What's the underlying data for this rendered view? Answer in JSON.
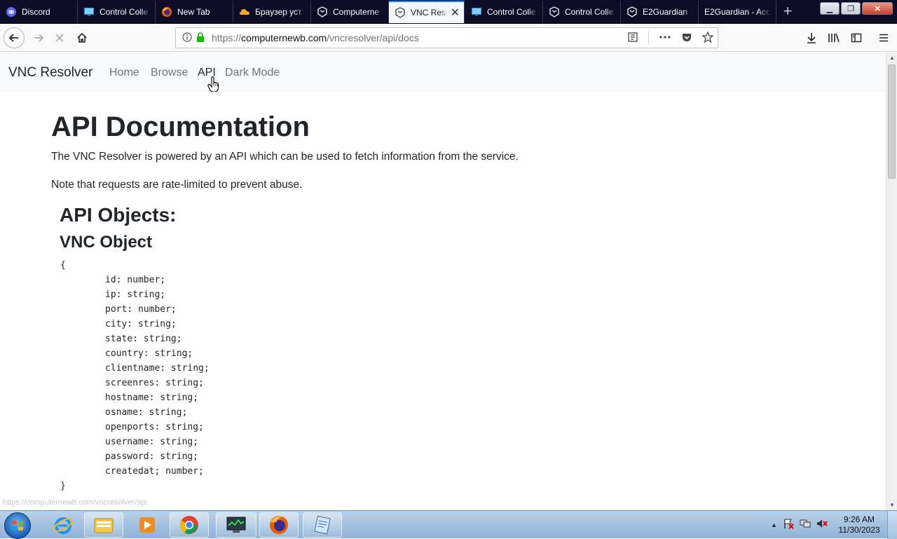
{
  "browser": {
    "tabs": [
      {
        "label": "Discord",
        "icon": "discord-icon",
        "active": false
      },
      {
        "label": "Control Colle",
        "icon": "monitor-icon",
        "active": false
      },
      {
        "label": "New Tab",
        "icon": "firefox-icon",
        "active": false
      },
      {
        "label": "Браузер уст",
        "icon": "cloud-icon",
        "active": false
      },
      {
        "label": "Computerne",
        "icon": "computernewb-icon",
        "active": false
      },
      {
        "label": "VNC Reso",
        "icon": "computernewb-icon",
        "active": true
      },
      {
        "label": "Control Colle",
        "icon": "monitor-icon",
        "active": false
      },
      {
        "label": "Control Colle",
        "icon": "computernewb-icon",
        "active": false
      },
      {
        "label": "E2Guardian",
        "icon": "computernewb-icon",
        "active": false
      },
      {
        "label": "E2Guardian - Acc",
        "icon": "",
        "active": false
      }
    ],
    "new_tab_label": "+",
    "window_controls": {
      "minimize": "▁",
      "maximize": "❐",
      "close": "✕"
    },
    "url": {
      "prefix": "https://",
      "host": "computernewb.com",
      "path": "/vncresolver/api/docs"
    }
  },
  "page": {
    "navbar": {
      "brand": "VNC Resolver",
      "links": [
        {
          "label": "Home",
          "active": false
        },
        {
          "label": "Browse",
          "active": false
        },
        {
          "label": "API",
          "active": true
        },
        {
          "label": "Dark Mode",
          "active": false
        }
      ]
    },
    "title": "API Documentation",
    "intro": "The VNC Resolver is powered by an API which can be used to fetch information from the service.",
    "note": "Note that requests are rate-limited to prevent abuse.",
    "objects_heading": "API Objects:",
    "vnc_object_heading": "VNC Object",
    "code_open": "{",
    "code_close": "}",
    "fields": [
      "id: number;",
      "ip: string;",
      "port: number;",
      "city: string;",
      "state: string;",
      "country: string;",
      "clientname: string;",
      "screenres: string;",
      "hostname: string;",
      "osname: string;",
      "openports: string;",
      "username: string;",
      "password: string;",
      "createdat; number;"
    ],
    "status_link": "https://computernewb.com/vncresolver/api"
  },
  "taskbar": {
    "apps": [
      "ie-icon",
      "explorer-icon",
      "media-player-icon",
      "chrome-icon",
      "task-manager-icon",
      "firefox-icon",
      "notepad-icon"
    ],
    "tray_expand": "▲",
    "clock": {
      "time": "9:26 AM",
      "date": "11/30/2023"
    }
  },
  "colors": {
    "accent": "#0a84ff",
    "tabstrip": "#0c0c26",
    "navbar": "#f8f9fa",
    "text": "#212529",
    "muted": "#6c757d"
  }
}
